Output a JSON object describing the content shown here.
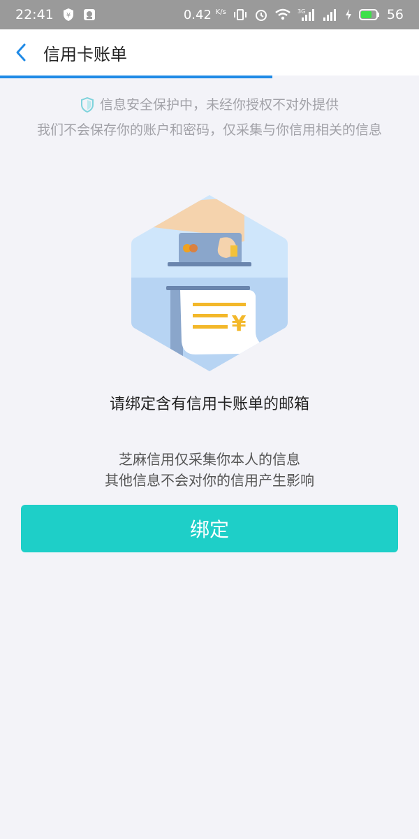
{
  "status_bar": {
    "time": "22:41",
    "speed": "0.42",
    "speed_unit": "K/s",
    "battery": "56",
    "network": "3G"
  },
  "nav": {
    "title": "信用卡账单"
  },
  "progress": {
    "fraction": 0.65,
    "color": "#1f8ae6"
  },
  "notice": {
    "line1": "信息安全保护中，未经你授权不对外提供",
    "line2": "我们不会保存你的账户和密码，仅采集与你信用相关的信息"
  },
  "illustration": {
    "currency_symbol": "¥"
  },
  "main": {
    "headline": "请绑定含有信用卡账单的邮箱",
    "desc_line1": "芝麻信用仅采集你本人的信息",
    "desc_line2": "其他信息不会对你的信用产生影响",
    "bind_label": "绑定"
  },
  "colors": {
    "accent": "#1ecfc8",
    "nav_icon": "#1f8ae6"
  }
}
